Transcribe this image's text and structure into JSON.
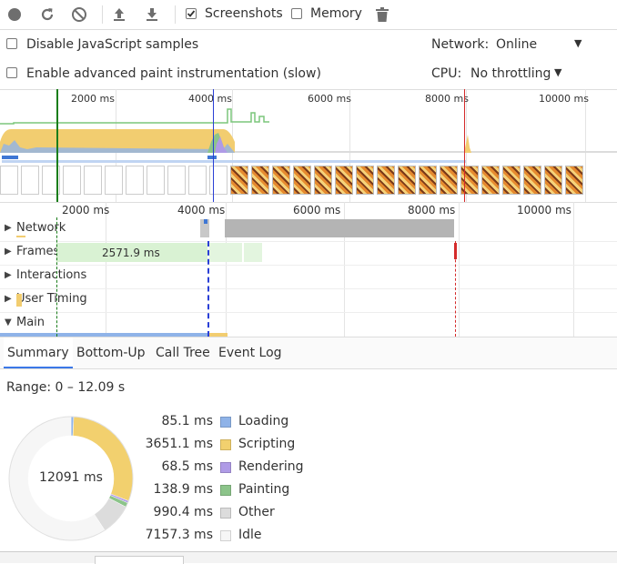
{
  "toolbar": {
    "screenshots_label": "Screenshots",
    "screenshots_checked": true,
    "memory_label": "Memory",
    "memory_checked": false
  },
  "settings": {
    "disable_js_samples": "Disable JavaScript samples",
    "advanced_paint": "Enable advanced paint instrumentation (slow)",
    "network_label": "Network:",
    "network_value": "Online",
    "cpu_label": "CPU:",
    "cpu_value": "No throttling"
  },
  "overview": {
    "ticks": [
      "2000 ms",
      "4000 ms",
      "6000 ms",
      "8000 ms",
      "10000 ms"
    ]
  },
  "flame": {
    "ticks": [
      "2000 ms",
      "4000 ms",
      "6000 ms",
      "8000 ms",
      "10000 ms"
    ],
    "tracks": [
      "Network",
      "Frames",
      "Interactions",
      "User Timing",
      "Main"
    ],
    "frame_label": "2571.9 ms"
  },
  "tabs": [
    "Summary",
    "Bottom-Up",
    "Call Tree",
    "Event Log"
  ],
  "summary": {
    "range": "Range: 0 – 12.09 s",
    "total": "12091 ms",
    "items": [
      {
        "value": "85.1 ms",
        "name": "Loading",
        "color": "#8fb3e8",
        "ms": 85.1
      },
      {
        "value": "3651.1 ms",
        "name": "Scripting",
        "color": "#f2d06e",
        "ms": 3651.1
      },
      {
        "value": "68.5 ms",
        "name": "Rendering",
        "color": "#af9be6",
        "ms": 68.5
      },
      {
        "value": "138.9 ms",
        "name": "Painting",
        "color": "#8cc48a",
        "ms": 138.9
      },
      {
        "value": "990.4 ms",
        "name": "Other",
        "color": "#dcdcdc",
        "ms": 990.4
      },
      {
        "value": "7157.3 ms",
        "name": "Idle",
        "color": "#f6f6f6",
        "ms": 7157.3
      }
    ]
  }
}
